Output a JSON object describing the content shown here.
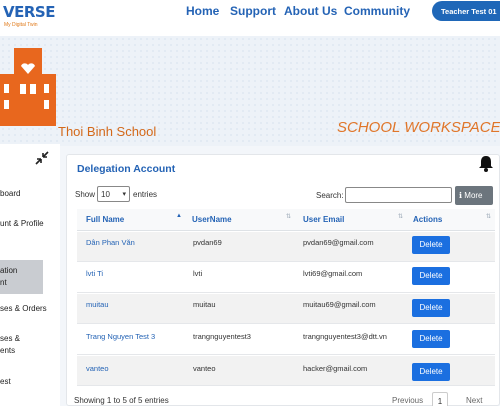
{
  "header": {
    "logo_text": "VERSE",
    "logo_tagline": "My Digital Twin",
    "nav": [
      "Home",
      "Support",
      "About Us",
      "Community"
    ],
    "user_button": "Teacher Test 01"
  },
  "banner": {
    "school_name": "Thoi Binh School",
    "workspace_title": "SCHOOL WORKSPACE"
  },
  "sidebar": {
    "items": [
      "board",
      "unt & Profile",
      "",
      "ation",
      "nt",
      "ses & Orders",
      "ses &",
      "ents",
      "est"
    ]
  },
  "main": {
    "title": "Delegation Account",
    "show_label": "Show",
    "entries_value": "10",
    "entries_label": "entries",
    "search_label": "Search:",
    "search_value": "",
    "more_label": "More",
    "columns": [
      "Full Name",
      "UserName",
      "User Email",
      "Actions"
    ],
    "rows": [
      {
        "full_name": "Dân Phan Văn",
        "username": "pvdan69",
        "email": "pvdan69@gmail.com",
        "action": "Delete"
      },
      {
        "full_name": "lvti Ti",
        "username": "lvti",
        "email": "lvti69@gmail.com",
        "action": "Delete"
      },
      {
        "full_name": "muitau",
        "username": "muitau",
        "email": "muitau69@gmail.com",
        "action": "Delete"
      },
      {
        "full_name": "Trang Nguyen Test 3",
        "username": "trangnguyentest3",
        "email": "trangnguyentest3@dtt.vn",
        "action": "Delete"
      },
      {
        "full_name": "vanteo",
        "username": "vanteo",
        "email": "hacker@gmail.com",
        "action": "Delete"
      }
    ],
    "footer_info": "Showing 1 to 5 of 5 entries",
    "pagination": {
      "previous": "Previous",
      "page": "1",
      "next": "Next"
    }
  },
  "colors": {
    "brand": "#2463b5",
    "accent": "#e07a1a",
    "delete": "#1b6fe0"
  }
}
